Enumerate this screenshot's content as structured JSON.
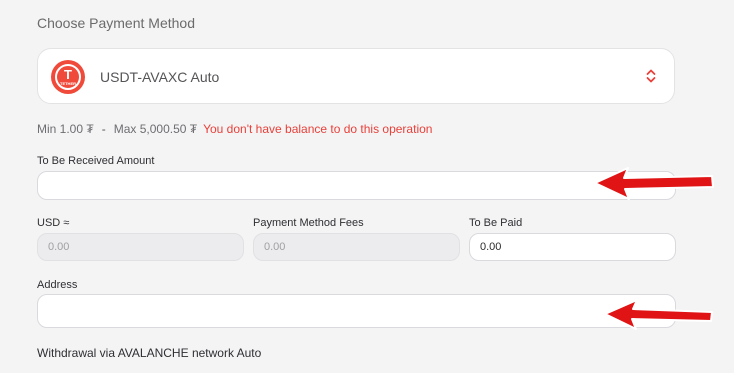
{
  "section_title": "Choose Payment Method",
  "payment_method": {
    "selected": "USDT-AVAXC Auto",
    "logo_icon": "tether-icon",
    "logo_letter": "T",
    "logo_caption": "TETHER",
    "brand_color": "#f04b3a"
  },
  "limits": {
    "min": "Min 1.00 ₮",
    "separator": "-",
    "max": "Max 5,000.50 ₮",
    "warning": "You don't have balance to do this operation",
    "warning_color": "#e8413a"
  },
  "received_amount": {
    "label": "To Be Received Amount",
    "value": ""
  },
  "usd": {
    "label": "USD ≈",
    "value": "0.00"
  },
  "fees": {
    "label": "Payment Method Fees",
    "value": "0.00"
  },
  "to_be_paid": {
    "label": "To Be Paid",
    "value": "0.00"
  },
  "address": {
    "label": "Address",
    "value": ""
  },
  "network_note": "Withdrawal via AVALANCHE network Auto",
  "annotation_color": "#e01414"
}
